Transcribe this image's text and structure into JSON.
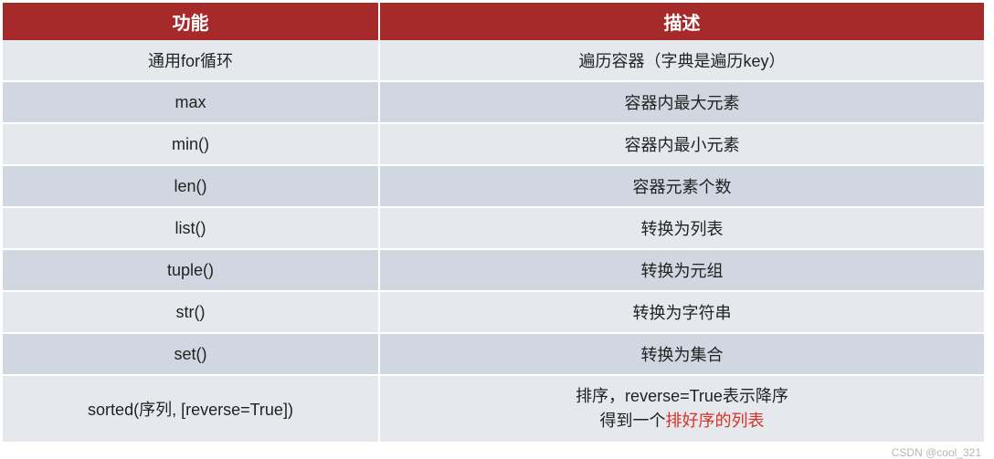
{
  "header": {
    "func": "功能",
    "desc": "描述"
  },
  "rows": [
    {
      "func": "通用for循环",
      "desc": "遍历容器（字典是遍历key）"
    },
    {
      "func": "max",
      "desc": "容器内最大元素"
    },
    {
      "func": "min()",
      "desc": "容器内最小元素"
    },
    {
      "func": "len()",
      "desc": "容器元素个数"
    },
    {
      "func": "list()",
      "desc": "转换为列表"
    },
    {
      "func": "tuple()",
      "desc": "转换为元组"
    },
    {
      "func": "str()",
      "desc": "转换为字符串"
    },
    {
      "func": "set()",
      "desc": "转换为集合"
    },
    {
      "func": "sorted(序列, [reverse=True])",
      "desc_line1": "排序，reverse=True表示降序",
      "desc_line2_prefix": "得到一个",
      "desc_line2_highlight": "排好序的列表"
    }
  ],
  "watermark": "CSDN @cool_321"
}
